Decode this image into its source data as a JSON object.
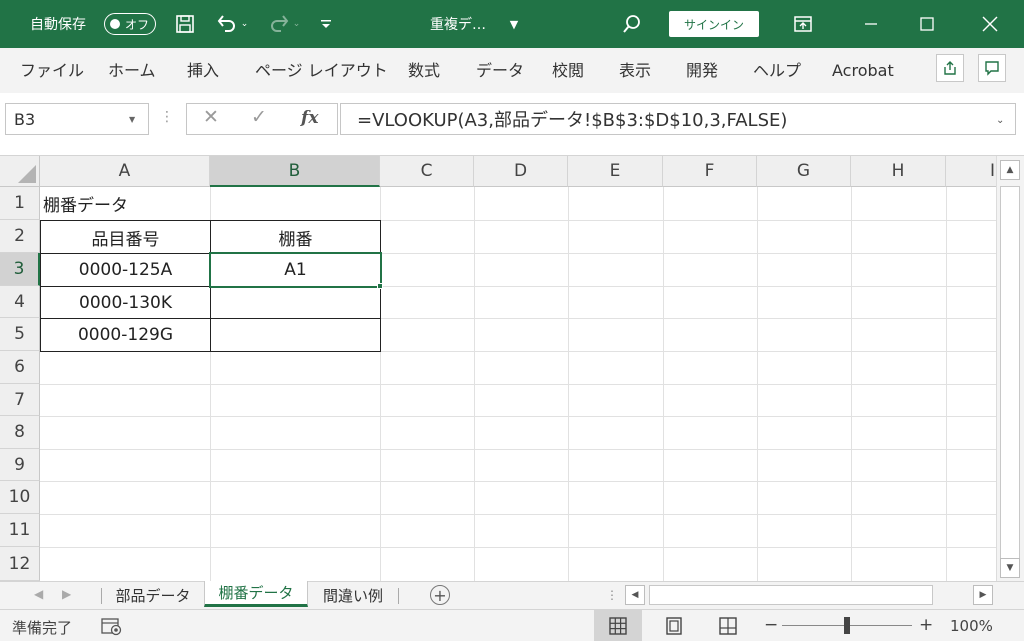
{
  "titlebar": {
    "autosave_label": "自動保存",
    "autosave_state": "オフ",
    "doc_title": "重複デ…",
    "signin_label": "サインイン"
  },
  "ribbon": {
    "tabs": [
      "ファイル",
      "ホーム",
      "挿入",
      "ページ レイアウト",
      "数式",
      "データ",
      "校閲",
      "表示",
      "開発",
      "ヘルプ",
      "Acrobat"
    ]
  },
  "formula_bar": {
    "name_box": "B3",
    "cancel_symbol": "✕",
    "enter_symbol": "✓",
    "fx_label": "fx",
    "formula": "=VLOOKUP(A3,部品データ!$B$3:$D$10,3,FALSE)"
  },
  "grid": {
    "columns": [
      "A",
      "B",
      "C",
      "D",
      "E",
      "F",
      "G",
      "H",
      "I"
    ],
    "rows": [
      "1",
      "2",
      "3",
      "4",
      "5",
      "6",
      "7",
      "8",
      "9",
      "10",
      "11",
      "12"
    ],
    "selected_column": "B",
    "selected_row": "3",
    "cells": {
      "A1": "棚番データ",
      "A2": "品目番号",
      "B2": "棚番",
      "A3": "0000-125A",
      "B3": "A1",
      "A4": "0000-130K",
      "A5": "0000-129G"
    }
  },
  "sheets": {
    "tabs": [
      "部品データ",
      "棚番データ",
      "間違い例"
    ],
    "active": "棚番データ"
  },
  "statusbar": {
    "status": "準備完了",
    "zoom_minus": "−",
    "zoom_plus": "+",
    "zoom": "100%"
  },
  "colors": {
    "excel_green": "#217346",
    "header_gray": "#efefef",
    "gridline": "#e1e1e1"
  }
}
